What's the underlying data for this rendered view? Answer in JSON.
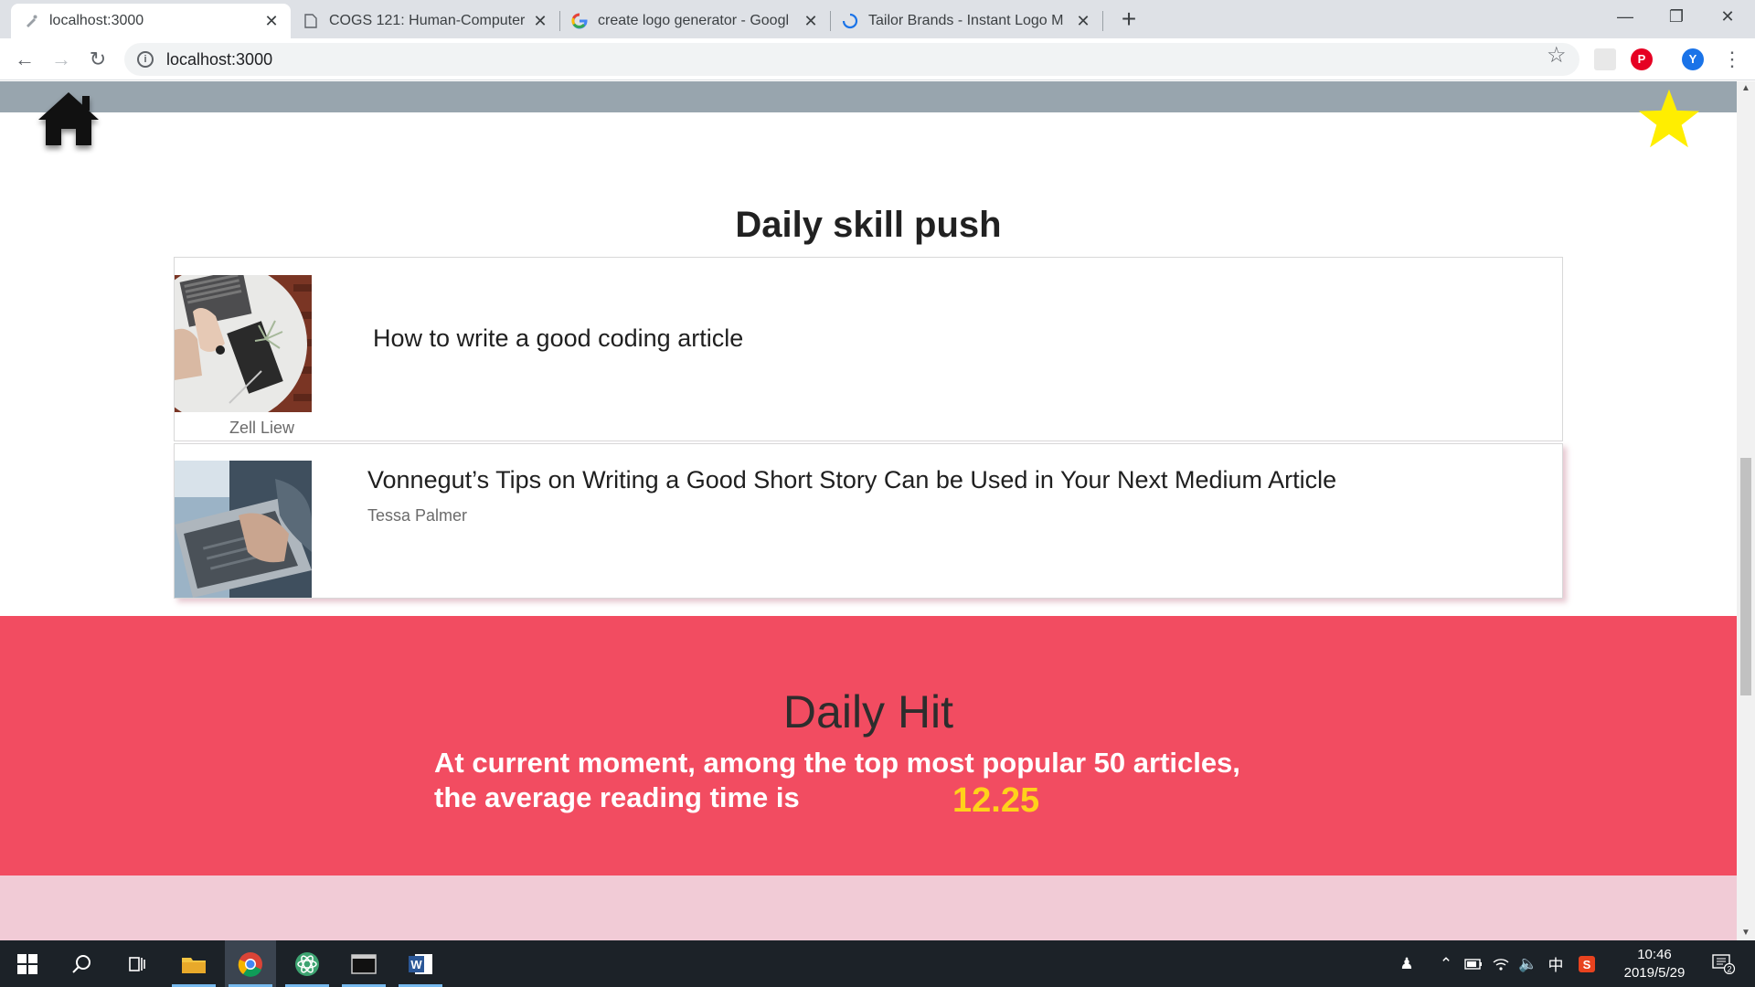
{
  "browser": {
    "tabs": [
      {
        "label": "localhost:3000",
        "active": true
      },
      {
        "label": "COGS 121: Human-Computer",
        "active": false
      },
      {
        "label": "create logo generator - Googl",
        "active": false
      },
      {
        "label": "Tailor Brands - Instant Logo M",
        "active": false
      }
    ],
    "url": "localhost:3000",
    "profile_initial": "Y"
  },
  "page": {
    "skill_section": {
      "title": "Daily skill push",
      "articles": [
        {
          "title": "How to write a good coding article",
          "author": "Zell Liew"
        },
        {
          "title": "Vonnegut’s Tips on Writing a Good Short Story Can be Used in Your Next Medium Article",
          "author": "Tessa Palmer"
        }
      ]
    },
    "hit_section": {
      "title": "Daily Hit",
      "line1": "At current moment, among the top most popular 50 articles,",
      "line2": "the average reading time is",
      "value": "12.25"
    },
    "colors": {
      "top_band": "#98a5ae",
      "hit_background": "#f24c61",
      "hit_value": "#ffd21a",
      "favorite_star": "#ffee00",
      "bottom_band": "#f1cbd6"
    }
  },
  "taskbar": {
    "time": "10:46",
    "date": "2019/5/29",
    "ime": "中",
    "notifications": "2"
  }
}
